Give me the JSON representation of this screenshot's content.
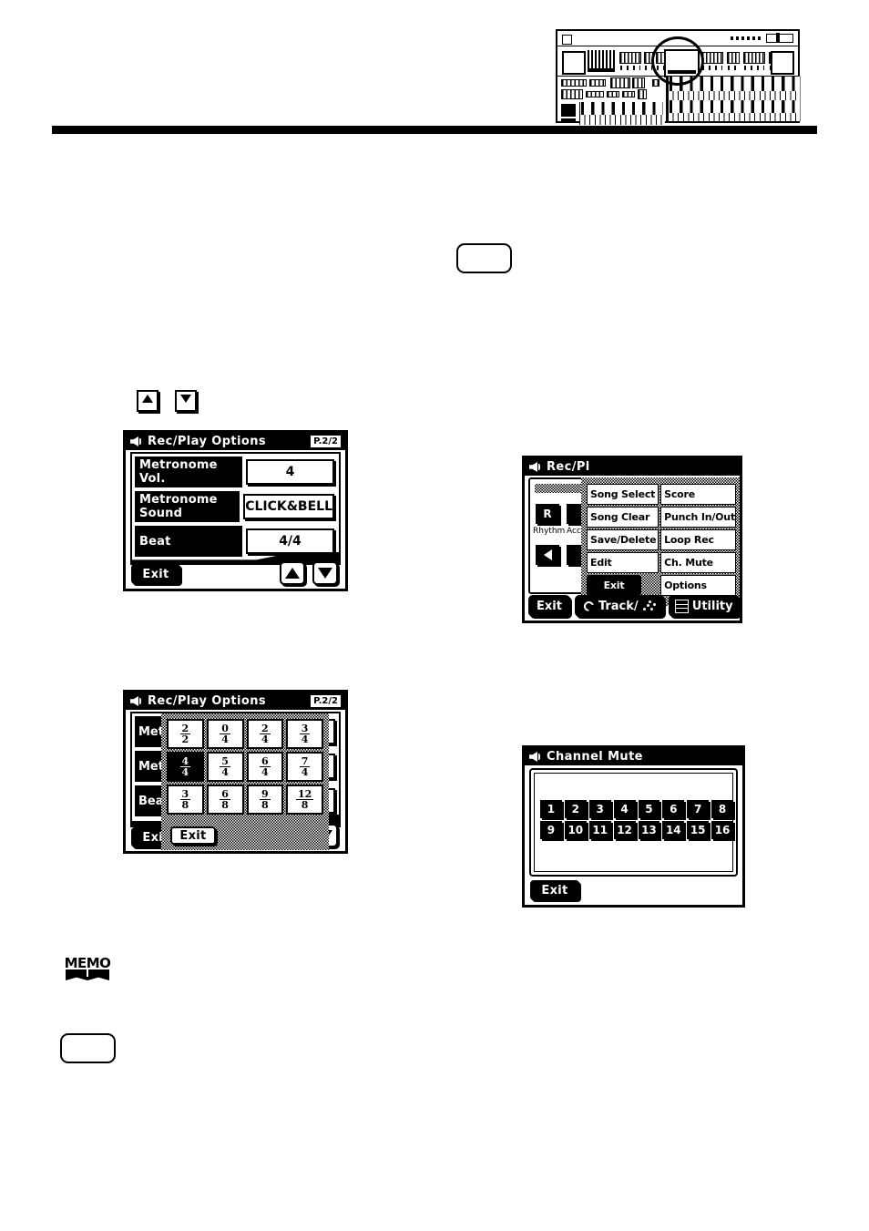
{
  "figure": {
    "name": "organ-keyboard-illustration",
    "callout": "display-screen-circled"
  },
  "placeholders": {
    "top_button": "",
    "bottom_button": ""
  },
  "body_controls": {
    "arrow_up": "up-arrow-button",
    "arrow_down": "down-arrow-button"
  },
  "memo": {
    "label": "MEMO"
  },
  "screens": {
    "rec_play_options": {
      "title": "Rec/Play Options",
      "page_badge": "P.2/2",
      "rows": [
        {
          "label": "Metronome Vol.",
          "value": "4"
        },
        {
          "label": "Metronome Sound",
          "value": "CLICK&BELL"
        },
        {
          "label": "Beat",
          "value": "4/4"
        }
      ],
      "exit_label": "Exit",
      "arrow_up": "up-arrow",
      "arrow_down": "down-arrow"
    },
    "beat_select": {
      "title": "Rec/Play Options",
      "page_badge": "P.2/2",
      "background_rows": [
        {
          "label": "Met"
        },
        {
          "label": "Met"
        },
        {
          "label": "Bea"
        }
      ],
      "beats": [
        {
          "num": "2",
          "den": "2",
          "selected": false
        },
        {
          "num": "0",
          "den": "4",
          "selected": false
        },
        {
          "num": "2",
          "den": "4",
          "selected": false
        },
        {
          "num": "3",
          "den": "4",
          "selected": false
        },
        {
          "num": "4",
          "den": "4",
          "selected": true
        },
        {
          "num": "5",
          "den": "4",
          "selected": false
        },
        {
          "num": "6",
          "den": "4",
          "selected": false
        },
        {
          "num": "7",
          "den": "4",
          "selected": false
        },
        {
          "num": "3",
          "den": "8",
          "selected": false
        },
        {
          "num": "6",
          "den": "8",
          "selected": false
        },
        {
          "num": "9",
          "den": "8",
          "selected": false
        },
        {
          "num": "12",
          "den": "8",
          "selected": false
        }
      ],
      "popup_exit_label": "Exit",
      "base_exit_label": "Exit"
    },
    "rec_play_menu": {
      "title": "Rec/Pl",
      "behind": {
        "rhythm_button": "R",
        "rhythm_label": "Rhythm",
        "acc_label": "Acc"
      },
      "menu_items": [
        "Song Select",
        "Score",
        "Song Clear",
        "Punch In/Out",
        "Save/Delete",
        "Loop Rec",
        "Edit",
        "Ch. Mute",
        "Exit",
        "Options"
      ],
      "bottom_bar": {
        "exit_label": "Exit",
        "track_label": "Track/",
        "utility_label": "Utility"
      }
    },
    "channel_mute": {
      "title": "Channel Mute",
      "channels": [
        "1",
        "2",
        "3",
        "4",
        "5",
        "6",
        "7",
        "8",
        "9",
        "10",
        "11",
        "12",
        "13",
        "14",
        "15",
        "16"
      ],
      "exit_label": "Exit"
    }
  }
}
